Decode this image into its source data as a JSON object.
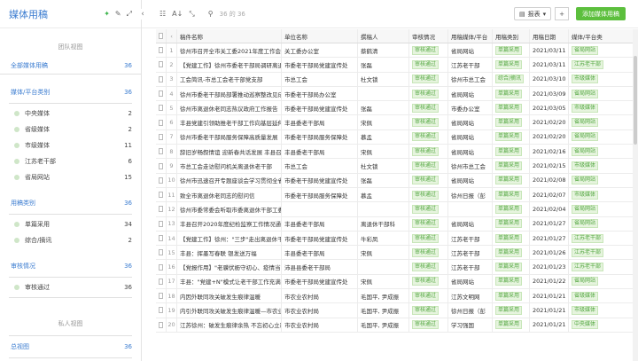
{
  "sidebar": {
    "title": "媒体用稿",
    "team_view_label": "团队视图",
    "all_media": {
      "label": "全部媒体用稿",
      "count": "36"
    },
    "platform_group": {
      "label": "媒体/平台类别",
      "count": "36"
    },
    "platform_items": [
      {
        "label": "中央媒体",
        "count": "2"
      },
      {
        "label": "省级媒体",
        "count": "2"
      },
      {
        "label": "市级媒体",
        "count": "11"
      },
      {
        "label": "江苏老干部",
        "count": "6"
      },
      {
        "label": "省局网站",
        "count": "15"
      }
    ],
    "usage_group": {
      "label": "用稿类别",
      "count": "36"
    },
    "usage_items": [
      {
        "label": "单篇采用",
        "count": "34"
      },
      {
        "label": "综合/摘讯",
        "count": "2"
      }
    ],
    "audit_group": {
      "label": "审核情况",
      "count": "36"
    },
    "audit_items": [
      {
        "label": "审核通过",
        "count": "36"
      }
    ],
    "private_view_label": "私人视图",
    "overview": {
      "label": "总视图",
      "count": "36"
    }
  },
  "toolbar": {
    "record_count": "36 的 36",
    "report_label": "报表",
    "add_label": "+",
    "new_button_label": "添加媒体用稿"
  },
  "table": {
    "headers": [
      "稿件名称",
      "单位名称",
      "撰稿人",
      "审核情况",
      "用稿媒体/平台",
      "用稿类别",
      "用稿日期",
      "媒体/平台类"
    ],
    "rows": [
      {
        "num": "1",
        "title": "徐州市召开全市关工委2021年度工作会议",
        "unit": "关工委办公室",
        "person": "蔡鹤清",
        "audit": "审核通过",
        "media": "省局网站",
        "type": "单篇采用",
        "date": "2021/03/11",
        "platform": "省局网站"
      },
      {
        "num": "2",
        "title": "【党建工作】徐州市委老干部局调研离退休",
        "unit": "市委老干部局党建宣传处",
        "person": "张磊",
        "audit": "审核通过",
        "media": "江苏老干部",
        "type": "单篇采用",
        "date": "2021/03/11",
        "platform": "江苏老干部"
      },
      {
        "num": "3",
        "title": "工会简讯-市总工会老干部党支部",
        "unit": "市总工会",
        "person": "杜文锁",
        "audit": "审核通过",
        "media": "徐州市总工会",
        "type": "综合/摘讯",
        "date": "2021/03/10",
        "platform": "市级媒体"
      },
      {
        "num": "4",
        "title": "徐州市委老干部局部署推动巡察整改见成效",
        "unit": "市委老干部局办公室",
        "person": "",
        "audit": "审核通过",
        "media": "省局网站",
        "type": "单篇采用",
        "date": "2021/03/09",
        "platform": "省局网站"
      },
      {
        "num": "5",
        "title": "徐州市离退休老同志热议政府工作报告",
        "unit": "市委老干部局党建宣传处",
        "person": "张磊",
        "audit": "审核通过",
        "media": "市委办公室",
        "type": "单篇采用",
        "date": "2021/03/05",
        "platform": "市级媒体"
      },
      {
        "num": "6",
        "title": "丰县党建引领助推老干部工作向基层延伸",
        "unit": "丰县委老干部局",
        "person": "宋佩",
        "audit": "审核通过",
        "media": "省局网站",
        "type": "单篇采用",
        "date": "2021/02/20",
        "platform": "省局网站"
      },
      {
        "num": "7",
        "title": "徐州市委老干部局服务保障高质量发展",
        "unit": "市委老干部局服务保障处",
        "person": "慕孟",
        "audit": "审核通过",
        "media": "省局网站",
        "type": "单篇采用",
        "date": "2021/02/20",
        "platform": "省局网站"
      },
      {
        "num": "8",
        "title": "辞旧岁畅叙情谊 迎新春共话发展 丰县召开",
        "unit": "丰县委老干部局",
        "person": "宋佩",
        "audit": "审核通过",
        "media": "省局网站",
        "type": "单篇采用",
        "date": "2021/02/16",
        "platform": "省局网站"
      },
      {
        "num": "9",
        "title": "市总工会走访慰问机关离退休老干部",
        "unit": "市总工会",
        "person": "杜文锁",
        "audit": "审核通过",
        "media": "徐州市总工会",
        "type": "单篇采用",
        "date": "2021/02/15",
        "platform": "市级媒体"
      },
      {
        "num": "10",
        "title": "徐州市迅速召开专题座谈会学习贯彻全省",
        "unit": "市委老干部局党建宣传处",
        "person": "张磊",
        "audit": "审核通过",
        "media": "省局网站",
        "type": "单篇采用",
        "date": "2021/02/08",
        "platform": "省局网站"
      },
      {
        "num": "11",
        "title": "致全市离退休老同志的慰问信",
        "unit": "市委老干部局服务保障处",
        "person": "慕孟",
        "audit": "审核通过",
        "media": "徐州日报（彭",
        "type": "单篇采用",
        "date": "2021/02/07",
        "platform": "市级媒体"
      },
      {
        "num": "12",
        "title": "徐州市委常委会听取市委离退休干部工委",
        "unit": "",
        "person": "",
        "audit": "审核通过",
        "media": "",
        "type": "单篇采用",
        "date": "2021/02/04",
        "platform": "省局网站"
      },
      {
        "num": "13",
        "title": "丰县召开2020年度纪检监察工作情况通报",
        "unit": "丰县委老干部局",
        "person": "离退休干部科",
        "audit": "审核通过",
        "media": "省局网站",
        "type": "单篇采用",
        "date": "2021/01/27",
        "platform": "省局网站"
      },
      {
        "num": "14",
        "title": "【党建工作】徐州：\"三步\"走出离退休干部",
        "unit": "市委老干部局党建宣传处",
        "person": "牛彩凤",
        "audit": "审核通过",
        "media": "江苏老干部",
        "type": "单篇采用",
        "date": "2021/01/27",
        "platform": "江苏老干部"
      },
      {
        "num": "15",
        "title": "丰县：挥墨写春联 银发送万福",
        "unit": "丰县委老干部局",
        "person": "宋佩",
        "audit": "审核通过",
        "media": "江苏老干部",
        "type": "单篇采用",
        "date": "2021/01/26",
        "platform": "江苏老干部"
      },
      {
        "num": "16",
        "title": "【党报作用】\"老骥伏枥守初心、疫情当前",
        "unit": "沛县县委老干部局",
        "person": "",
        "audit": "审核通过",
        "media": "江苏老干部",
        "type": "单篇采用",
        "date": "2021/01/23",
        "platform": "江苏老干部"
      },
      {
        "num": "17",
        "title": "丰县：\"党建+N\"模式让老干部工作充满活力",
        "unit": "市委老干部局党建宣传处",
        "person": "宋佩",
        "audit": "审核通过",
        "media": "省局网站",
        "type": "单篇采用",
        "date": "2021/01/22",
        "platform": "省局网站"
      },
      {
        "num": "18",
        "title": "内因外联同攻关破发生痕律温暖",
        "unit": "市农业农村局",
        "person": "毛国平, 尹成振",
        "audit": "审核通过",
        "media": "江苏文明网",
        "type": "单篇采用",
        "date": "2021/01/21",
        "platform": "省级媒体"
      },
      {
        "num": "19",
        "title": "内引外联同攻关破发生痕律温暖—市农业",
        "unit": "市农业农村局",
        "person": "毛国平, 尹成振",
        "audit": "审核通过",
        "media": "徐州日报（彭",
        "type": "单篇采用",
        "date": "2021/01/21",
        "platform": "市级媒体"
      },
      {
        "num": "20",
        "title": "江苏徐州：破发生痕律余热 不忘初心立新功",
        "unit": "市农业农村局",
        "person": "毛国平, 尹成振",
        "audit": "审核通过",
        "media": "学习强国",
        "type": "单篇采用",
        "date": "2021/01/21",
        "platform": "中央媒体"
      }
    ]
  }
}
